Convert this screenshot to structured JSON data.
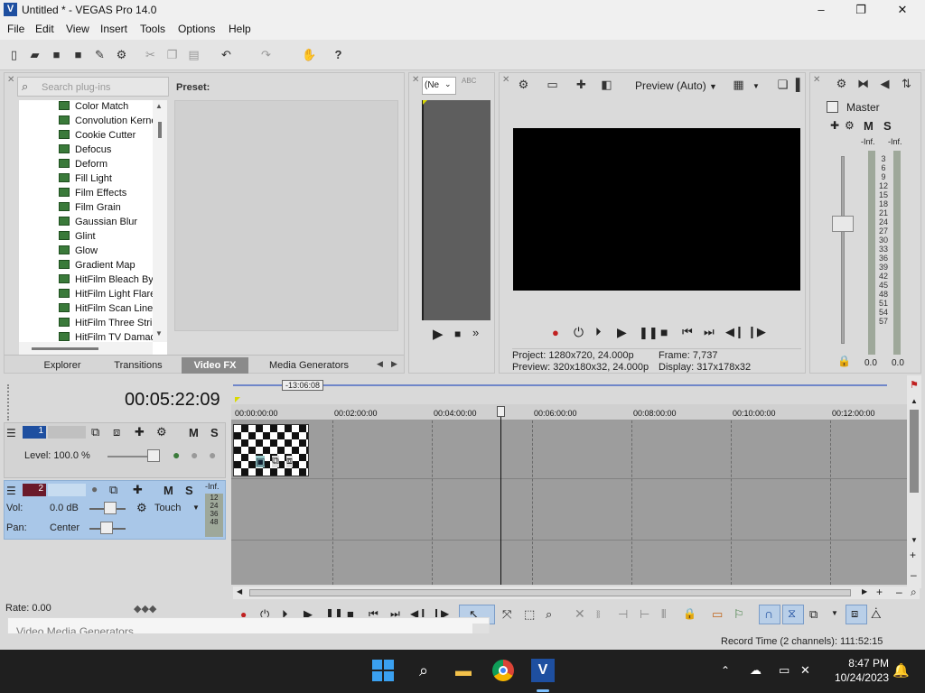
{
  "window": {
    "title": "Untitled * - VEGAS Pro 14.0",
    "min": "–",
    "max": "❐",
    "close": "✕"
  },
  "menu": [
    "File",
    "Edit",
    "View",
    "Insert",
    "Tools",
    "Options",
    "Help"
  ],
  "plugins": {
    "search_placeholder": "Search plug-ins",
    "preset_label": "Preset:",
    "items": [
      "Color Match",
      "Convolution Kernel",
      "Cookie Cutter",
      "Defocus",
      "Deform",
      "Fill Light",
      "Film Effects",
      "Film Grain",
      "Gaussian Blur",
      "Glint",
      "Glow",
      "Gradient Map",
      "HitFilm Bleach Bypass",
      "HitFilm Light Flares",
      "HitFilm Scan Lines",
      "HitFilm Three Strip",
      "HitFilm TV Damage"
    ]
  },
  "tabs": [
    "Explorer",
    "Transitions",
    "Video FX",
    "Media Generators"
  ],
  "trimmer": {
    "dropdown": "(Ne"
  },
  "preview": {
    "mode": "Preview (Auto)",
    "project_label": "Project:",
    "project_value": "1280x720, 24.000p",
    "preview_label": "Preview:",
    "preview_value": "320x180x32, 24.000p",
    "frame_label": "Frame:",
    "frame_value": "7,737",
    "display_label": "Display:",
    "display_value": "317x178x32"
  },
  "master": {
    "title": "Master",
    "m": "M",
    "s": "S",
    "inf_left": "-Inf.",
    "inf_right": "-Inf.",
    "scale": [
      "3",
      "6",
      "9",
      "12",
      "15",
      "18",
      "21",
      "24",
      "27",
      "30",
      "33",
      "36",
      "39",
      "42",
      "45",
      "48",
      "51",
      "54",
      "57"
    ],
    "val_left": "0.0",
    "val_right": "0.0"
  },
  "timeline": {
    "timecode": "00:05:22:09",
    "cursor_time": "-13:06:08",
    "ruler": [
      "00:00:00:00",
      "00:02:00:00",
      "00:04:00:00",
      "00:06:00:00",
      "00:08:00:00",
      "00:10:00:00",
      "00:12:00:00"
    ],
    "video_track": {
      "num": "1",
      "m": "M",
      "s": "S",
      "level": "Level: 100.0 %"
    },
    "audio_track": {
      "num": "2",
      "m": "M",
      "s": "S",
      "vol_label": "Vol:",
      "vol_value": "0.0 dB",
      "pan_label": "Pan:",
      "pan_value": "Center",
      "touch": "Touch",
      "inf": "-Inf.",
      "meter": [
        "12",
        "24",
        "36",
        "48"
      ]
    },
    "rate": "Rate: 0.00"
  },
  "tooltip": "Video Media Generators",
  "status": "Record Time (2 channels): 111:52:15",
  "clock": {
    "time": "8:47 PM",
    "date": "10/24/2023"
  },
  "colors": {
    "accent": "#1e4fa0",
    "audio_header": "#a9c7e8",
    "video_header": "#d8d8d8",
    "preview_bg": "#000000"
  }
}
